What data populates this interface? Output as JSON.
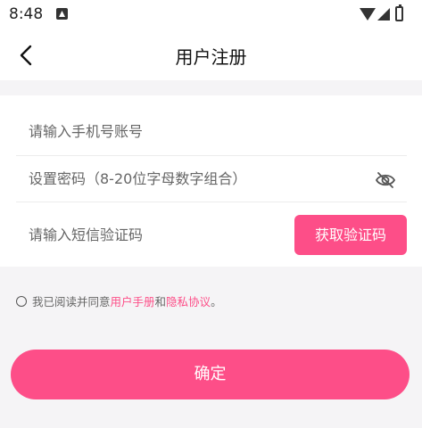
{
  "status_bar": {
    "time": "8:48",
    "icons": [
      "notification-a-icon",
      "wifi-icon",
      "signal-icon",
      "battery-icon"
    ]
  },
  "header": {
    "title": "用户注册",
    "back_icon": "chevron-left-icon"
  },
  "form": {
    "phone_placeholder": "请输入手机号账号",
    "password_placeholder": "设置密码（8-20位字母数字组合）",
    "password_visibility_icon": "eye-off-icon",
    "code_placeholder": "请输入短信验证码",
    "get_code_label": "获取验证码"
  },
  "agreement": {
    "prefix": "我已阅读并同意",
    "user_manual": "用户手册",
    "and": "和",
    "privacy": "隐私协议",
    "suffix": "。"
  },
  "submit_label": "确定",
  "colors": {
    "accent": "#fd4e88",
    "background": "#f5f4f6"
  }
}
